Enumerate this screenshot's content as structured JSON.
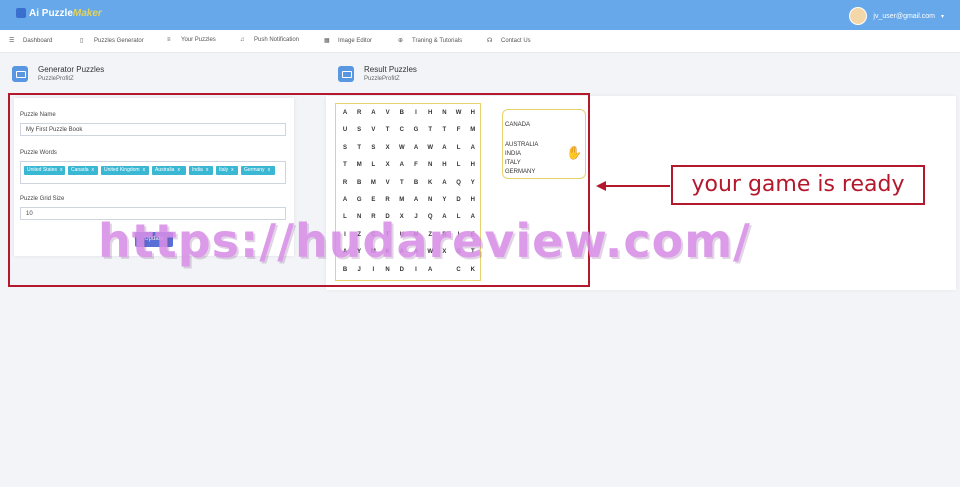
{
  "app": {
    "logo_text_1": "Ai Puzzle",
    "logo_text_2": "Maker",
    "user_email": "jv_user@gmail.com"
  },
  "nav": [
    {
      "label": "Dashboard",
      "icon": "menu-icon"
    },
    {
      "label": "Puzzles Generator",
      "icon": "phone-icon"
    },
    {
      "label": "Your Puzzles",
      "icon": "list-icon"
    },
    {
      "label": "Push Notification",
      "icon": "bell-icon"
    },
    {
      "label": "Image Editor",
      "icon": "image-icon"
    },
    {
      "label": "Traning & Tutorials",
      "icon": "plus-circle-icon"
    },
    {
      "label": "Contact Us",
      "icon": "headset-icon"
    }
  ],
  "generator": {
    "title": "Generator Puzzles",
    "subtitle": "PuzzleProfitZ",
    "name_label": "Puzzle Name",
    "name_value": "My First Puzzle Book",
    "words_label": "Puzzle Words",
    "words": [
      "United States",
      "Canada",
      "United Kingdom",
      "Australia",
      "India",
      "Italy",
      "Germany"
    ],
    "grid_label": "Puzzle Grid Size",
    "grid_value": "10",
    "update_label": "Update"
  },
  "result": {
    "title": "Result Puzzles",
    "subtitle": "PuzzleProfitZ",
    "rows": [
      "ARAVBIHNWH",
      "USVTCGTTFM",
      "STSXWAWALA",
      "TMLXAFNHLH",
      "RBMVTBKAQY",
      "AGERMANYDH",
      "LNRDXJQALA",
      "IZCTUMZRIE",
      "AYMKAAWXGT",
      "BJINDIA CK"
    ],
    "word_list": [
      "CANADA",
      "",
      "AUSTRALIA",
      "INDIA",
      "ITALY",
      "GERMANY"
    ]
  },
  "annotation": {
    "callout": "your game is ready",
    "watermark": "https://hudareview.com/"
  }
}
